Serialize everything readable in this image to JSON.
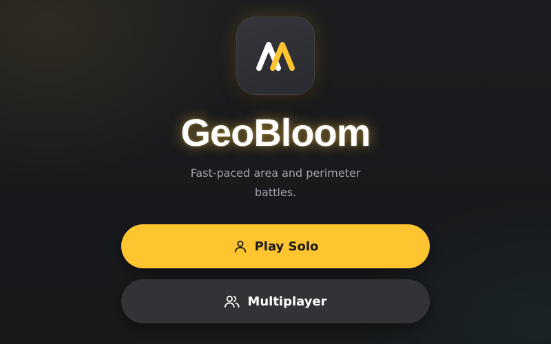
{
  "app": {
    "title": "GeoBloom",
    "subtitle": "Fast-paced area and perimeter battles.",
    "logo_icon": "geobloom-logo-icon",
    "accent_color": "#fec530"
  },
  "menu": {
    "play_solo": {
      "label": "Play Solo",
      "icon": "user-icon"
    },
    "multiplayer": {
      "label": "Multiplayer",
      "icon": "users-icon"
    }
  }
}
